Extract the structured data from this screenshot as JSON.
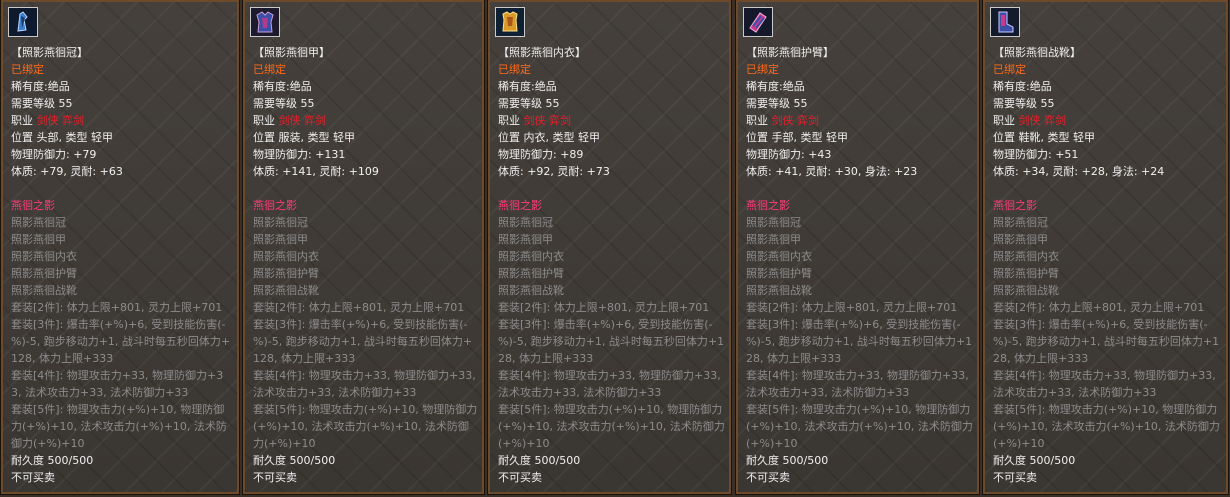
{
  "items": [
    {
      "icon": "helmet-icon",
      "name": "【照影燕徊冠】",
      "bound": "已绑定",
      "rarity": "稀有度:绝品",
      "level": "需要等级 55",
      "class_label": "职业",
      "class_value": "剑侠 弈剑",
      "slot_label": "位置 头部, 类型 轻甲",
      "phys_def": "物理防御力: +79",
      "stats": "体质: +79, 灵耐: +63",
      "set_name": "燕徊之影",
      "set_pieces": [
        "照影燕徊冠",
        "照影燕徊甲",
        "照影燕徊内衣",
        "照影燕徊护臂",
        "照影燕徊战靴"
      ],
      "bonus2": "套装[2件]: 体力上限+801, 灵力上限+701",
      "bonus3": "套装[3件]: 爆击率(+%)+6, 受到技能伤害(-%)-5, 跑步移动力+1, 战斗时每五秒回体力+128, 体力上限+333",
      "bonus4": "套装[4件]: 物理攻击力+33, 物理防御力+33, 法术攻击力+33, 法术防御力+33",
      "bonus5": "套装[5件]: 物理攻击力(+%)+10, 物理防御力(+%)+10, 法术攻击力(+%)+10, 法术防御力(+%)+10",
      "durability": "耐久度 500/500",
      "trade": "不可买卖"
    },
    {
      "icon": "armor-icon",
      "name": "【照影燕徊甲】",
      "bound": "已绑定",
      "rarity": "稀有度:绝品",
      "level": "需要等级 55",
      "class_label": "职业",
      "class_value": "剑侠 弈剑",
      "slot_label": "位置 服装, 类型 轻甲",
      "phys_def": "物理防御力: +131",
      "stats": "体质: +141, 灵耐: +109",
      "set_name": "燕徊之影",
      "set_pieces": [
        "照影燕徊冠",
        "照影燕徊甲",
        "照影燕徊内衣",
        "照影燕徊护臂",
        "照影燕徊战靴"
      ],
      "bonus2": "套装[2件]: 体力上限+801, 灵力上限+701",
      "bonus3": "套装[3件]: 爆击率(+%)+6, 受到技能伤害(-%)-5, 跑步移动力+1, 战斗时每五秒回体力+128, 体力上限+333",
      "bonus4": "套装[4件]: 物理攻击力+33, 物理防御力+33, 法术攻击力+33, 法术防御力+33",
      "bonus5": "套装[5件]: 物理攻击力(+%)+10, 物理防御力(+%)+10, 法术攻击力(+%)+10, 法术防御力(+%)+10",
      "durability": "耐久度 500/500",
      "trade": "不可买卖"
    },
    {
      "icon": "inner-vest-icon",
      "name": "【照影燕徊内衣】",
      "bound": "已绑定",
      "rarity": "稀有度:绝品",
      "level": "需要等级 55",
      "class_label": "职业",
      "class_value": "剑侠 弈剑",
      "slot_label": "位置 内衣, 类型 轻甲",
      "phys_def": "物理防御力: +89",
      "stats": "体质: +92, 灵耐: +73",
      "set_name": "燕徊之影",
      "set_pieces": [
        "照影燕徊冠",
        "照影燕徊甲",
        "照影燕徊内衣",
        "照影燕徊护臂",
        "照影燕徊战靴"
      ],
      "bonus2": "套装[2件]: 体力上限+801, 灵力上限+701",
      "bonus3": "套装[3件]: 爆击率(+%)+6, 受到技能伤害(-%)-5, 跑步移动力+1, 战斗时每五秒回体力+128, 体力上限+333",
      "bonus4": "套装[4件]: 物理攻击力+33, 物理防御力+33, 法术攻击力+33, 法术防御力+33",
      "bonus5": "套装[5件]: 物理攻击力(+%)+10, 物理防御力(+%)+10, 法术攻击力(+%)+10, 法术防御力(+%)+10",
      "durability": "耐久度 500/500",
      "trade": "不可买卖"
    },
    {
      "icon": "bracer-icon",
      "name": "【照影燕徊护臂】",
      "bound": "已绑定",
      "rarity": "稀有度:绝品",
      "level": "需要等级 55",
      "class_label": "职业",
      "class_value": "剑侠 弈剑",
      "slot_label": "位置 手部, 类型 轻甲",
      "phys_def": "物理防御力: +43",
      "stats": "体质: +41, 灵耐: +30, 身法: +23",
      "set_name": "燕徊之影",
      "set_pieces": [
        "照影燕徊冠",
        "照影燕徊甲",
        "照影燕徊内衣",
        "照影燕徊护臂",
        "照影燕徊战靴"
      ],
      "bonus2": "套装[2件]: 体力上限+801, 灵力上限+701",
      "bonus3": "套装[3件]: 爆击率(+%)+6, 受到技能伤害(-%)-5, 跑步移动力+1, 战斗时每五秒回体力+128, 体力上限+333",
      "bonus4": "套装[4件]: 物理攻击力+33, 物理防御力+33, 法术攻击力+33, 法术防御力+33",
      "bonus5": "套装[5件]: 物理攻击力(+%)+10, 物理防御力(+%)+10, 法术攻击力(+%)+10, 法术防御力(+%)+10",
      "durability": "耐久度 500/500",
      "trade": "不可买卖"
    },
    {
      "icon": "boots-icon",
      "name": "【照影燕徊战靴】",
      "bound": "已绑定",
      "rarity": "稀有度:绝品",
      "level": "需要等级 55",
      "class_label": "职业",
      "class_value": "剑侠 弈剑",
      "slot_label": "位置 鞋靴, 类型 轻甲",
      "phys_def": "物理防御力: +51",
      "stats": "体质: +34, 灵耐: +28, 身法: +24",
      "set_name": "燕徊之影",
      "set_pieces": [
        "照影燕徊冠",
        "照影燕徊甲",
        "照影燕徊内衣",
        "照影燕徊护臂",
        "照影燕徊战靴"
      ],
      "bonus2": "套装[2件]: 体力上限+801, 灵力上限+701",
      "bonus3": "套装[3件]: 爆击率(+%)+6, 受到技能伤害(-%)-5, 跑步移动力+1, 战斗时每五秒回体力+128, 体力上限+333",
      "bonus4": "套装[4件]: 物理攻击力+33, 物理防御力+33, 法术攻击力+33, 法术防御力+33",
      "bonus5": "套装[5件]: 物理攻击力(+%)+10, 物理防御力(+%)+10, 法术攻击力(+%)+10, 法术防御力(+%)+10",
      "durability": "耐久度 500/500",
      "trade": "不可买卖"
    }
  ],
  "colors": {
    "bound": "#ff6a1a",
    "class_value": "#e8202a",
    "set_name": "#ff3c78",
    "inactive_set": "#8c8c8c",
    "frame": "#6d4a2a"
  }
}
